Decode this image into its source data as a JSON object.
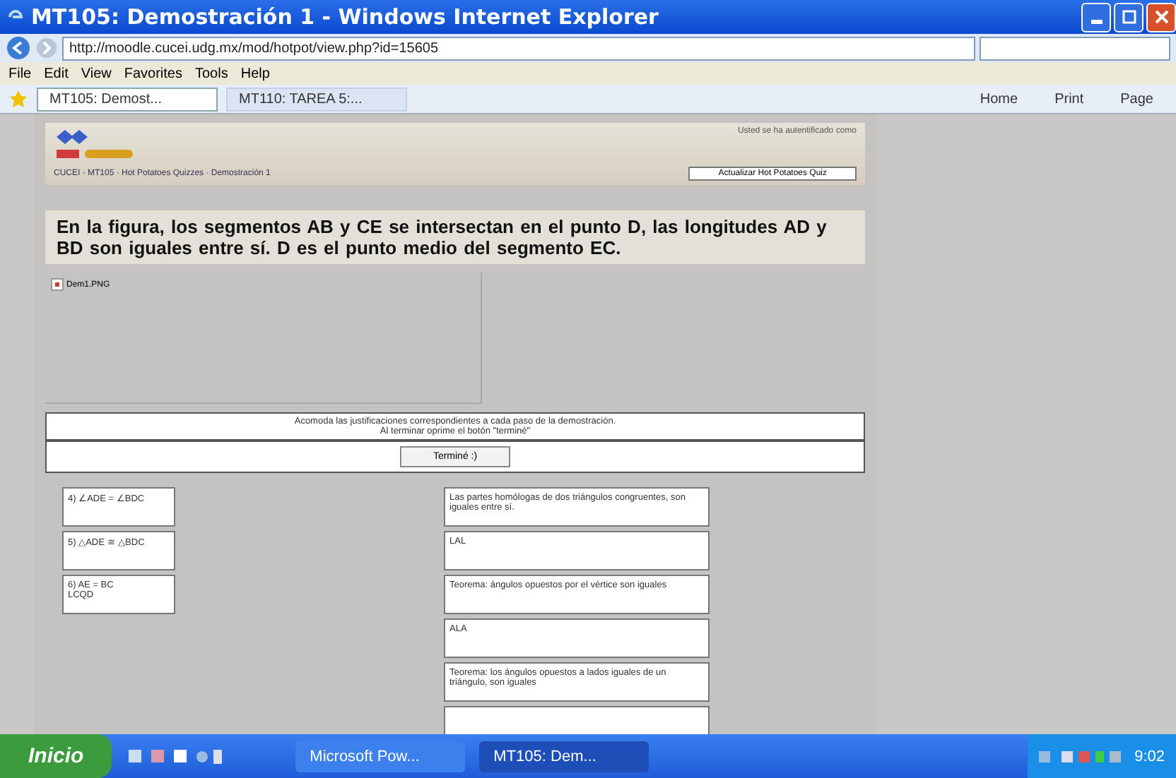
{
  "window": {
    "title": "MT105: Demostración 1 - Windows Internet Explorer"
  },
  "address_bar": {
    "url": "http://moodle.cucei.udg.mx/mod/hotpot/view.php?id=15605"
  },
  "menu_bar": [
    "File",
    "Edit",
    "View",
    "Favorites",
    "Tools",
    "Help"
  ],
  "tabs": [
    {
      "label": "MT105: Demost...",
      "selected": true
    },
    {
      "label": "MT110: TAREA 5:...",
      "selected": false
    }
  ],
  "command_bar": [
    "Home",
    "Print",
    "Page"
  ],
  "moodle": {
    "login_text": "Usted se ha autentificado como",
    "breadcrumb": "CUCEI · MT105 · Hot Potatoes Quizzes · Demostración 1",
    "update_button": "Actualizar Hot Potatoes Quiz"
  },
  "question": "En la figura, los segmentos AB y CE se intersectan en el punto D, las longitudes AD y BD son iguales entre sí. D es el punto medio del segmento EC.",
  "image_alt": "Dem1.PNG",
  "instructions": [
    "Acomoda las justificaciones correspondientes a cada paso de la demostración.",
    "Al terminar oprime el botón \"terminé\""
  ],
  "finish_button": "Terminé :)",
  "steps": [
    "4) ∠ADE = ∠BDC",
    "5) △ADE ≅ △BDC",
    "6) AE = BC\nLCQD"
  ],
  "justifications": [
    "Las partes homólogas de dos triángulos congruentes, son iguales entre sí.",
    "LAL",
    "Teorema: ángulos opuestos por el vértice son iguales",
    "ALA",
    "Teorema: los ángulos opuestos a lados iguales de un triángulo, son iguales"
  ],
  "taskbar": {
    "start": "Inicio",
    "items": [
      {
        "label": "Microsoft Pow...",
        "selected": false
      },
      {
        "label": "MT105: Dem...",
        "selected": true
      }
    ],
    "clock": "9:02"
  }
}
